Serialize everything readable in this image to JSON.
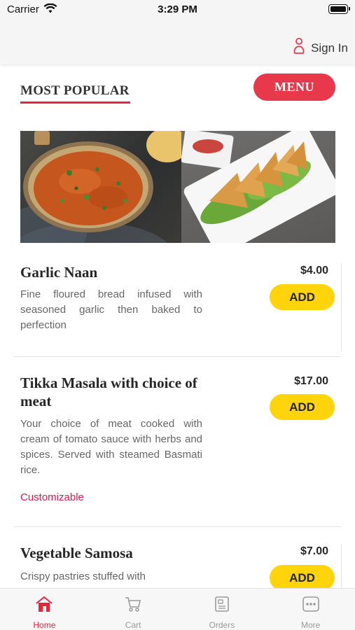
{
  "status_bar": {
    "carrier": "Carrier",
    "time": "3:29 PM"
  },
  "header": {
    "sign_in_label": "Sign In"
  },
  "section": {
    "title": "MOST POPULAR",
    "menu_button": "MENU"
  },
  "items": [
    {
      "name": "Garlic Naan",
      "price": "$4.00",
      "description": "Fine floured bread infused with seasoned garlic then baked to perfection",
      "add_label": "ADD"
    },
    {
      "name": "Tikka Masala with choice of meat",
      "price": "$17.00",
      "description": "Your choice of meat cooked with cream of tomato sauce with herbs and spices. Served with steamed Basmati rice.",
      "badge": "Customizable",
      "add_label": "ADD"
    },
    {
      "name": "Vegetable Samosa",
      "price": "$7.00",
      "description": "Crispy pastries stuffed with",
      "add_label": "ADD"
    }
  ],
  "tabs": [
    {
      "label": "Home",
      "icon": "home-icon",
      "active": true
    },
    {
      "label": "Cart",
      "icon": "cart-icon",
      "active": false
    },
    {
      "label": "Orders",
      "icon": "orders-icon",
      "active": false
    },
    {
      "label": "More",
      "icon": "more-icon",
      "active": false
    }
  ],
  "colors": {
    "accent": "#e8233b",
    "menu_button": "#e8384c",
    "add_button": "#ffd40a",
    "customizable": "#d81b4d"
  }
}
